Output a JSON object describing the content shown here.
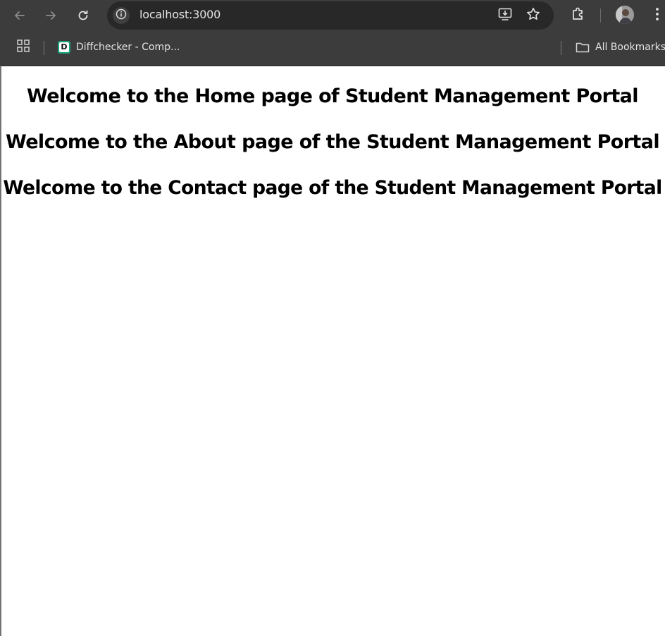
{
  "browser": {
    "url": "localhost:3000",
    "icons": {
      "back": "arrow-left-icon",
      "forward": "arrow-right-icon",
      "reload": "reload-icon",
      "site_info": "info-icon",
      "install": "install-app-icon",
      "bookmark": "star-icon",
      "extensions": "puzzle-icon",
      "profile": "avatar",
      "menu": "kebab-menu-icon"
    }
  },
  "bookmarks_bar": {
    "apps_icon": "apps-grid-icon",
    "items": [
      {
        "label": "Diffchecker - Comp...",
        "favicon_letter": "D",
        "favicon_color": "#1aa37a"
      }
    ],
    "all_bookmarks_label": "All Bookmarks"
  },
  "page": {
    "headings": [
      "Welcome to the Home page of Student Management Portal",
      "Welcome to the About page of the Student Management Portal",
      "Welcome to the Contact page of the Student Management Portal"
    ]
  },
  "colors": {
    "chrome_toolbar": "#3c3c3c",
    "omnibox": "#282828",
    "page_background": "#ffffff",
    "heading_text": "#000000"
  }
}
